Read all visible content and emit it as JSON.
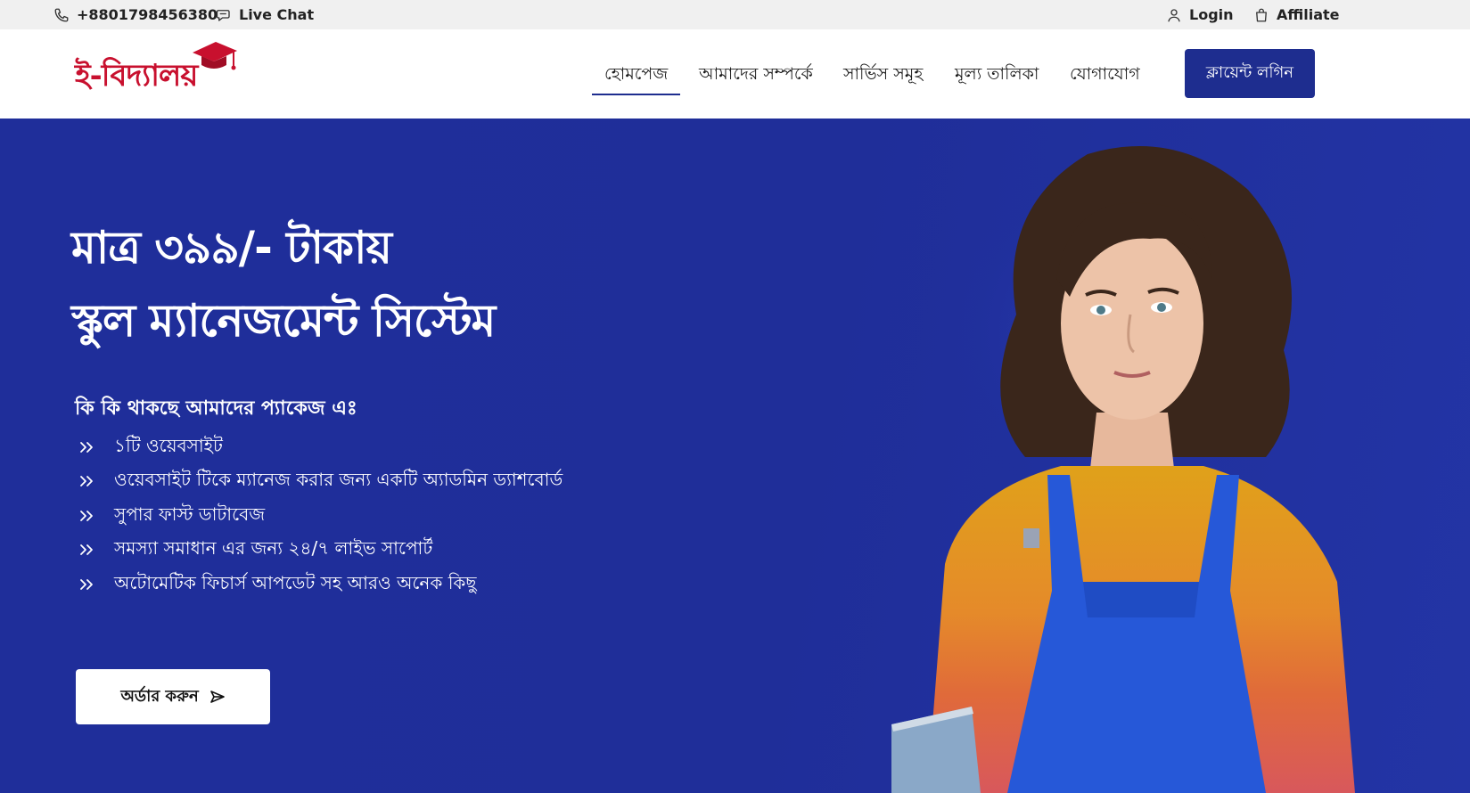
{
  "topbar": {
    "phone": "+8801798456380",
    "live_chat": "Live Chat",
    "login": "Login",
    "affiliate": "Affiliate"
  },
  "logo": {
    "text": "ই-বিদ্যালয়"
  },
  "nav": {
    "items": [
      {
        "label": "হোমপেজ"
      },
      {
        "label": "আমাদের সম্পর্কে"
      },
      {
        "label": "সার্ভিস সমূহ"
      },
      {
        "label": "মূল্য তালিকা"
      },
      {
        "label": "যোগাযোগ"
      }
    ],
    "client_login": "ক্লায়েন্ট লগিন"
  },
  "hero": {
    "title_line1": "মাত্র ৩৯৯/- টাকায়",
    "title_line2": "স্কুল ম্যানেজমেন্ট সিস্টেম",
    "package_heading": "কি কি থাকছে আমাদের প্যাকেজ এঃ",
    "features": [
      "১টি ওয়েবসাইট",
      "ওয়েবসাইট টিকে ম্যানেজ করার জন্য একটি অ্যাডমিন ড্যাশবোর্ড",
      "সুপার ফাস্ট ডাটাবেজ",
      "সমস্যা সমাধান এর জন্য ২৪/৭ লাইভ সাপোর্ট",
      "অটোমেটিক ফিচার্স আপডেট সহ আরও অনেক কিছু"
    ],
    "order_button": "অর্ডার করুন"
  },
  "colors": {
    "brand_blue": "#1e2d8f",
    "hero_bg": "#1f2e9a",
    "logo_red": "#c8102e"
  },
  "icons": {
    "phone": "phone-icon",
    "chat": "chat-icon",
    "user": "user-icon",
    "bag": "shopping-bag-icon",
    "feature_bullet": "double-chevron-right-icon",
    "order": "send-icon"
  }
}
